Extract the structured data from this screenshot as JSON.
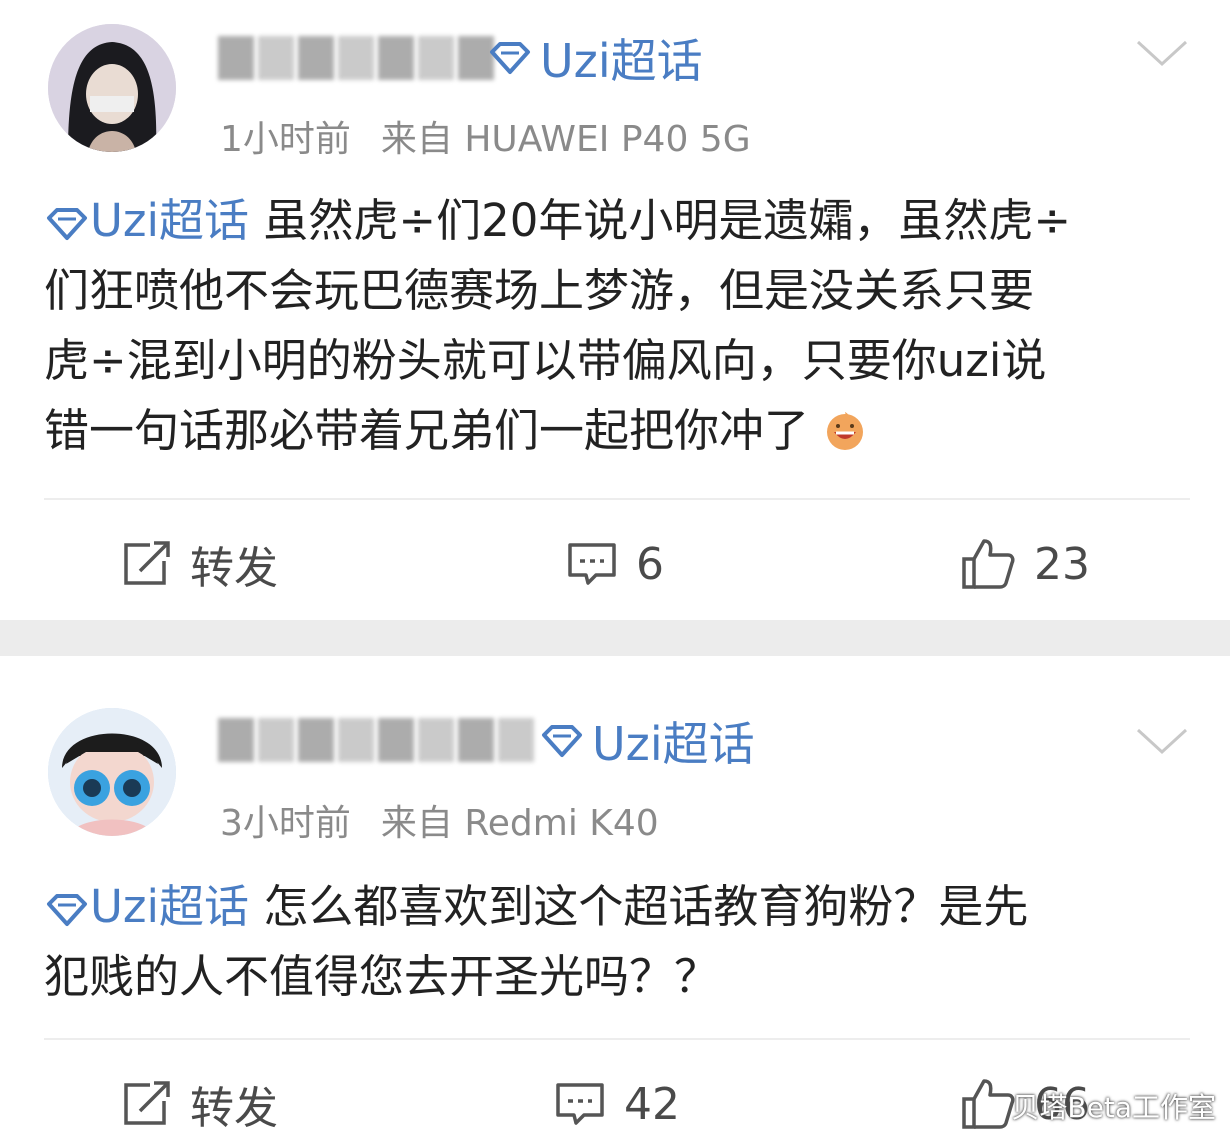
{
  "posts": [
    {
      "tag_label": "Uzi超话",
      "time": "1小时前",
      "source": "来自 HUAWEI P40 5G",
      "content_tag": "Uzi超话",
      "content_lines": [
        " 虽然虎÷们20年说小明是遗孀，虽然虎÷",
        "们狂喷他不会玩巴德赛场上梦游，但是没关系只要",
        "虎÷混到小明的粉头就可以带偏风向，只要你uzi说",
        "错一句话那必带着兄弟们一起把你冲了"
      ],
      "actions": {
        "repost_label": "转发",
        "comment_count": "6",
        "like_count": "23"
      }
    },
    {
      "tag_label": "Uzi超话",
      "time": "3小时前",
      "source": "来自 Redmi K40",
      "content_tag": "Uzi超话",
      "content_lines": [
        " 怎么都喜欢到这个超话教育狗粉？是先",
        "犯贱的人不值得您去开圣光吗？？"
      ],
      "actions": {
        "repost_label": "转发",
        "comment_count": "42",
        "like_count": "66"
      }
    }
  ],
  "watermark": "贝塔Beta工作室",
  "colors": {
    "accent": "#4a7dc3",
    "meta": "#8a8a8a",
    "separator": "#ececec"
  },
  "icons": [
    "diamond-icon",
    "chevron-down-icon",
    "repost-icon",
    "comment-icon",
    "like-icon",
    "emoji-icon"
  ]
}
